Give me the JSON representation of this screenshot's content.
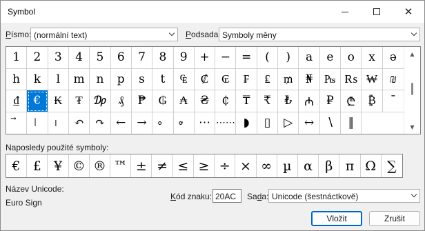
{
  "window": {
    "title": "Symbol"
  },
  "font": {
    "label_u": "P",
    "label_rest": "ísmo:",
    "value": "(normální text)"
  },
  "subset": {
    "label_u": "P",
    "label_rest": "odsada:",
    "value": "Symboly měny"
  },
  "grid": {
    "rows": [
      [
        "1",
        "2",
        "3",
        "4",
        "5",
        "6",
        "7",
        "8",
        "9",
        "+",
        "−",
        "=",
        "(",
        ")",
        "a",
        "e",
        "o",
        "x",
        "ə"
      ],
      [
        "h",
        "k",
        "l",
        "m",
        "n",
        "p",
        "s",
        "t",
        "₠",
        "₡",
        "₢",
        "₣",
        "₤",
        "₥",
        "₦",
        "₧",
        "₨",
        "₩",
        "₪"
      ],
      [
        "₫",
        "€",
        "₭",
        "₮",
        "₯",
        "₰",
        "₱",
        "₲",
        "₳",
        "₴",
        "₵",
        "₸",
        "₹",
        "₺",
        "₼",
        "₽",
        "₾",
        "₿",
        "ˉ"
      ],
      [
        "⃗",
        "⃒",
        "⃓",
        "↶",
        "↷",
        "←",
        "→",
        "⃘",
        "⃙",
        "⋯",
        "⋯⋯",
        "◗",
        "▯",
        "▷",
        "↔",
        "∖",
        "‖",
        "",
        ""
      ]
    ],
    "selected": {
      "row": 2,
      "col": 1
    }
  },
  "recent": {
    "label": "Naposledy použité symboly:",
    "items": [
      "€",
      "£",
      "¥",
      "©",
      "®",
      "™",
      "±",
      "≠",
      "≤",
      "≥",
      "÷",
      "×",
      "∞",
      "µ",
      "α",
      "β",
      "π",
      "Ω",
      "∑"
    ]
  },
  "unicode_name": {
    "label": "Název Unicode:",
    "value": "Euro Sign"
  },
  "char_code": {
    "label_u": "K",
    "label_rest": "ód znaku:",
    "value": "20AC"
  },
  "from": {
    "label_pre": "Sa",
    "label_u": "d",
    "label_rest": "a:",
    "value": "Unicode (šestnáctkově)"
  },
  "buttons": {
    "insert": "Vložit",
    "cancel": "Zrušit"
  }
}
